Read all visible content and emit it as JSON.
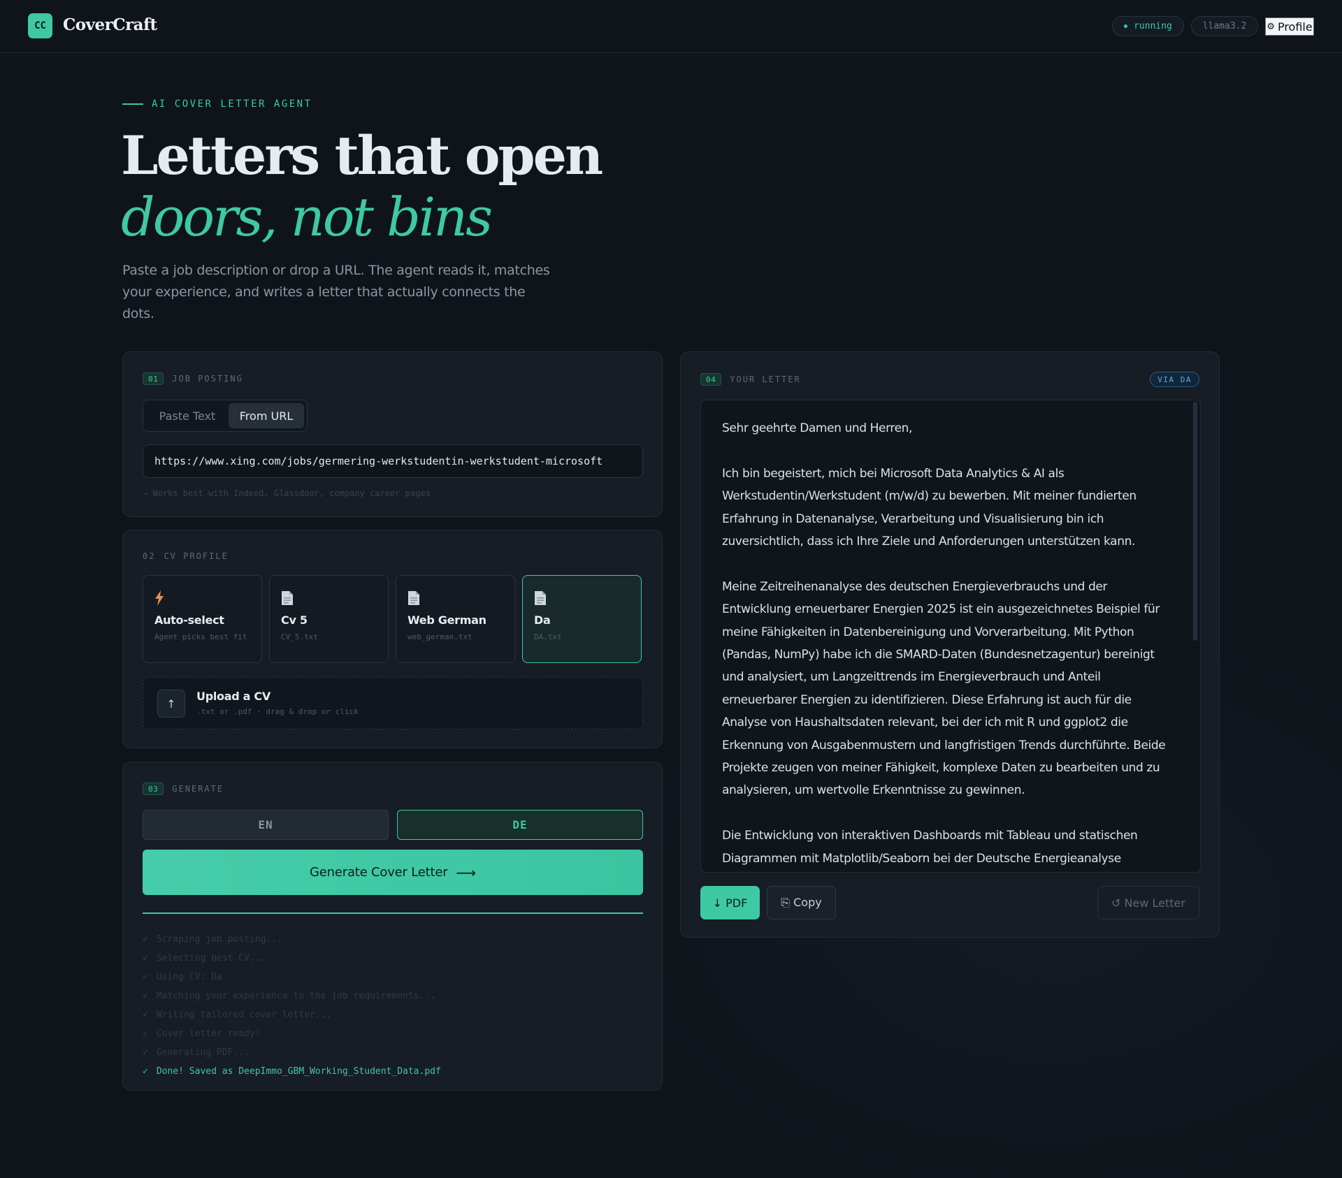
{
  "header": {
    "logo_badge": "CC",
    "app_name": "CoverCraft",
    "status": "running",
    "model": "llama3.2",
    "profile_icon": "gear-icon",
    "profile_label": "Profile"
  },
  "hero": {
    "eyebrow": "AI COVER LETTER AGENT",
    "title_line1": "Letters that open",
    "title_line2": "doors, not bins",
    "subtitle": "Paste a job description or drop a URL. The agent reads it, matches your experience, and writes a letter that actually connects the dots."
  },
  "job_posting": {
    "num": "01",
    "label": "JOB POSTING",
    "tabs": [
      {
        "label": "Paste Text",
        "active": false
      },
      {
        "label": "From URL",
        "active": true
      }
    ],
    "url_value": "https://www.xing.com/jobs/germering-werkstudentin-werkstudent-microsoft",
    "hint": "→ Works best with Indeed, Glassdoor, company career pages"
  },
  "cv_profile": {
    "num": "02",
    "label": "CV PROFILE",
    "cards": [
      {
        "title": "Auto-select",
        "sub": "Agent picks best fit",
        "icon": "lightning-icon",
        "selected": false
      },
      {
        "title": "Cv 5",
        "sub": "CV_5.txt",
        "icon": "document-icon",
        "selected": false
      },
      {
        "title": "Web German",
        "sub": "web_german.txt",
        "icon": "document-icon",
        "selected": false
      },
      {
        "title": "Da",
        "sub": "DA.txt",
        "icon": "document-icon",
        "selected": true
      }
    ],
    "upload": {
      "icon": "upload-arrow-icon",
      "title": "Upload a CV",
      "sub": ".txt or .pdf · drag & drop or click"
    }
  },
  "generate": {
    "num": "03",
    "label": "GENERATE",
    "languages": [
      {
        "label": "EN",
        "selected": false
      },
      {
        "label": "DE",
        "selected": true
      }
    ],
    "button_label": "Generate Cover Letter",
    "button_arrow": "⟶",
    "progress": 1.0,
    "log": [
      "Scraping job posting...",
      "Selecting best CV...",
      "Using CV: Da",
      "Matching your experience to the job requirements...",
      "Writing tailored cover letter...",
      "Cover letter ready!",
      "Generating PDF...",
      "Done! Saved as DeepImmo_GBM_Working_Student_Data.pdf"
    ]
  },
  "letter": {
    "num": "04",
    "label": "YOUR LETTER",
    "via": "VIA DA",
    "paragraphs": [
      "Sehr geehrte Damen und Herren,",
      "Ich bin begeistert, mich bei Microsoft Data Analytics & AI als Werkstudentin/Werkstudent (m/w/d) zu bewerben. Mit meiner fundierten Erfahrung in Datenanalyse, Verarbeitung und Visualisierung bin ich zuversichtlich, dass ich Ihre Ziele und Anforderungen unterstützen kann.",
      "Meine Zeitreihenanalyse des deutschen Energieverbrauchs und der Entwicklung erneuerbarer Energien 2025 ist ein ausgezeichnetes Beispiel für meine Fähigkeiten in Datenbereinigung und Vorverarbeitung. Mit Python (Pandas, NumPy) habe ich die SMARD-Daten (Bundesnetzagentur) bereinigt und analysiert, um Langzeittrends im Energieverbrauch und Anteil erneuerbarer Energien zu identifizieren. Diese Erfahrung ist auch für die Analyse von Haushaltsdaten relevant, bei der ich mit R und ggplot2 die Erkennung von Ausgabenmustern und langfristigen Trends durchführte. Beide Projekte zeugen von meiner Fähigkeit, komplexe Daten zu bearbeiten und zu analysieren, um wertvolle Erkenntnisse zu gewinnen.",
      "Die Entwicklung von interaktiven Dashboards mit Tableau und statischen Diagrammen mit Matplotlib/Seaborn bei der Deutsche Energieanalyse Verbrauch"
    ],
    "actions": {
      "pdf": "↓ PDF",
      "copy": "⎘ Copy",
      "new": "↺ New Letter"
    }
  },
  "colors": {
    "accent": "#3ec9a3",
    "background": "#0f141b",
    "panel": "#161d25",
    "via_blue": "#5aa8e6",
    "lightning": "#e0915a"
  }
}
